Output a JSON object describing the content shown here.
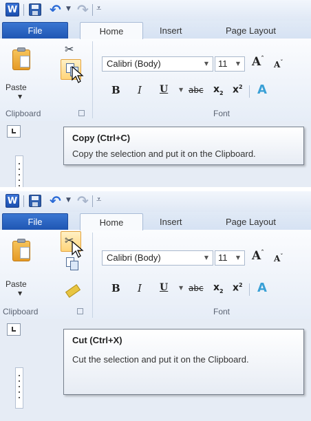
{
  "panels": [
    {
      "title_bar": {
        "app_icon": "W"
      },
      "tabs": {
        "file": "File",
        "home": "Home",
        "insert": "Insert",
        "page_layout": "Page Layout"
      },
      "clipboard": {
        "paste_label": "Paste",
        "group_label": "Clipboard",
        "hovered_button": "copy"
      },
      "font": {
        "font_name": "Calibri (Body)",
        "font_size": "11",
        "group_label": "Font"
      },
      "tooltip": {
        "title": "Copy (Ctrl+C)",
        "body": "Copy the selection and put it on the Clipboard."
      }
    },
    {
      "title_bar": {
        "app_icon": "W"
      },
      "tabs": {
        "file": "File",
        "home": "Home",
        "insert": "Insert",
        "page_layout": "Page Layout"
      },
      "clipboard": {
        "paste_label": "Paste",
        "group_label": "Clipboard",
        "hovered_button": "cut"
      },
      "font": {
        "font_name": "Calibri (Body)",
        "font_size": "11",
        "group_label": "Font"
      },
      "tooltip": {
        "title": "Cut (Ctrl+X)",
        "body": "Cut the selection and put it on the Clipboard."
      }
    }
  ],
  "icons": {
    "cut": "scissors-icon",
    "copy": "copy-icon",
    "format_painter": "brush-icon",
    "grow_font": "grow-font-icon",
    "shrink_font": "shrink-font-icon",
    "undo": "undo-icon",
    "redo": "redo-icon"
  },
  "colors": {
    "file_tab": "#2a62bf",
    "hover_highlight": "#ffd57a",
    "tooltip_border": "#767f8c"
  }
}
